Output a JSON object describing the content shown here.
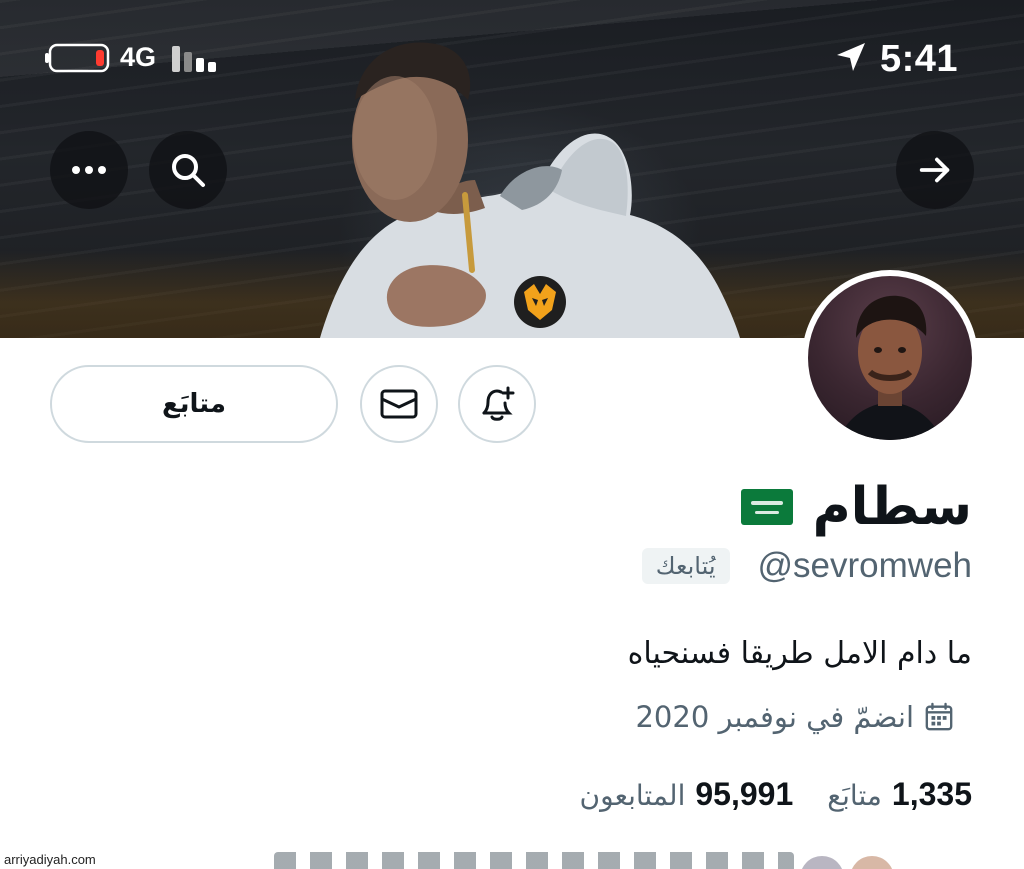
{
  "status_bar": {
    "time": "5:41",
    "network": "4G",
    "battery_level": 0.12,
    "battery_color": "#ff3b30",
    "icons": [
      "battery-icon",
      "signal-bars-icon",
      "location-arrow-icon"
    ]
  },
  "header": {
    "icons": [
      "more-dots-icon",
      "search-icon",
      "back-arrow-icon"
    ]
  },
  "profile": {
    "display_name": "سطام",
    "flag": "saudi-flag-icon",
    "handle": "@sevromweh",
    "follows_you": "يُتابعك",
    "bio": "ما دام الامل طريقا فسنحياه",
    "joined": "انضمّ في نوفمبر 2020",
    "following_count": "1,335",
    "following_label": "متابَع",
    "followers_count": "95,991",
    "followers_label": "المتابعون"
  },
  "actions": {
    "follow_label": "متابَع",
    "message_icon": "envelope-icon",
    "notify_icon": "bell-plus-icon"
  },
  "watermark": "arriyadiyah.com",
  "colors": {
    "text_primary": "#0f1419",
    "text_secondary": "#536471",
    "border": "#cfd9de",
    "badge_bg": "#eff3f4",
    "flag_green": "#0b7a3b"
  }
}
